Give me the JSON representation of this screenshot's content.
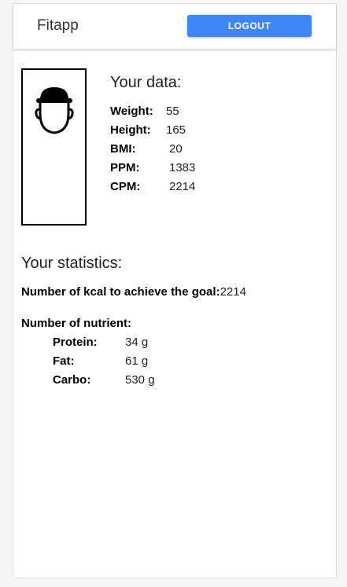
{
  "header": {
    "app_title": "Fitapp",
    "logout_label": "LOGOUT",
    "logout_color": "#3f86f7"
  },
  "avatar": {
    "icon": "person-head-with-cap-icon"
  },
  "user_data": {
    "title": "Your data:",
    "rows": [
      {
        "label": "Weight:",
        "value": "55"
      },
      {
        "label": "Height:",
        "value": "165"
      },
      {
        "label": "BMI:",
        "value": "20"
      },
      {
        "label": "PPM:",
        "value": "1383"
      },
      {
        "label": "CPM:",
        "value": "2214"
      }
    ]
  },
  "statistics": {
    "title": "Your statistics:",
    "kcal_label": "Number of kcal to achieve the goal:",
    "kcal_value": "2214",
    "nutrient_heading": "Number of nutrient:",
    "nutrients": [
      {
        "label": "Protein:",
        "value": "34 g"
      },
      {
        "label": "Fat:",
        "value": "61 g"
      },
      {
        "label": "Carbo:",
        "value": "530 g"
      }
    ]
  }
}
